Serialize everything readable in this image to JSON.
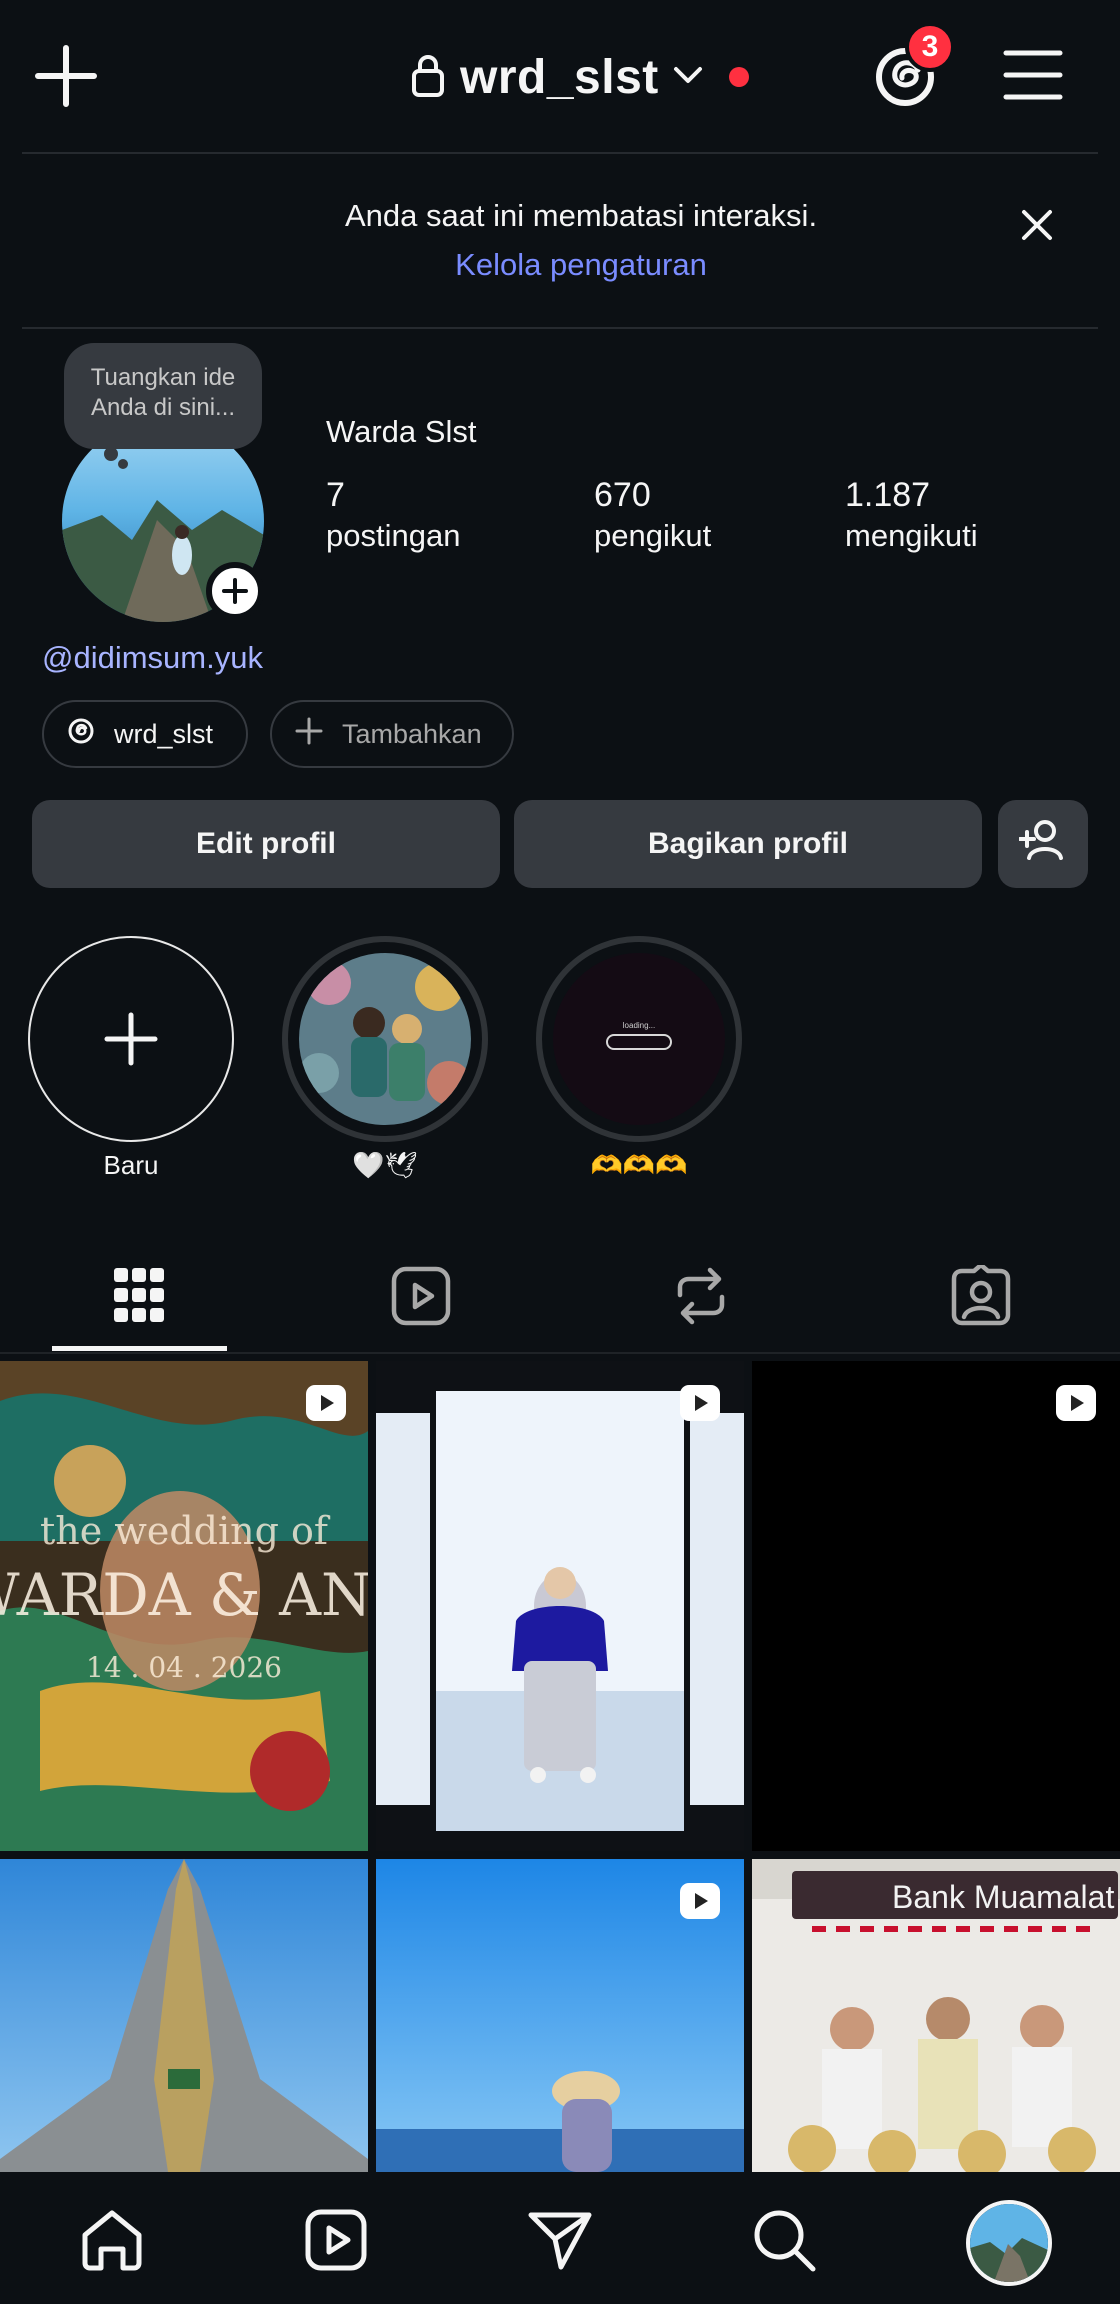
{
  "header": {
    "username": "wrd_slst",
    "threads_badge_count": "3"
  },
  "notice": {
    "message": "Anda saat ini membatasi interaksi.",
    "link": "Kelola pengaturan"
  },
  "profile": {
    "note_placeholder": "Tuangkan ide Anda di sini...",
    "display_name": "Warda Slst",
    "stats": [
      {
        "value": "7",
        "label": "postingan"
      },
      {
        "value": "670",
        "label": "pengikut"
      },
      {
        "value": "1.187",
        "label": "mengikuti"
      }
    ],
    "mention": "@didimsum.yuk",
    "threads_chip": "wrd_slst",
    "add_chip": "Tambahkan"
  },
  "buttons": {
    "edit": "Edit profil",
    "share": "Bagikan profil"
  },
  "highlights": [
    {
      "label": "Baru"
    },
    {
      "label": "🤍🕊"
    },
    {
      "label": "🫶🫶🫶"
    }
  ],
  "highlight_caption": "loading...",
  "grid_tiles": [
    {
      "caption_1": "the wedding of",
      "caption_2": "WARDA & ANDI",
      "caption_3": "14 . 04 . 2026",
      "reel": true
    },
    {
      "reel": true
    },
    {
      "reel": true
    },
    {
      "reel": false
    },
    {
      "reel": true
    },
    {
      "sign": "Bank Muamalat",
      "reel": false
    }
  ],
  "colors": {
    "background": "#0c1014",
    "accent_link": "#7a8cff",
    "badge_red": "#ff3040",
    "button_bg": "#363a40"
  }
}
